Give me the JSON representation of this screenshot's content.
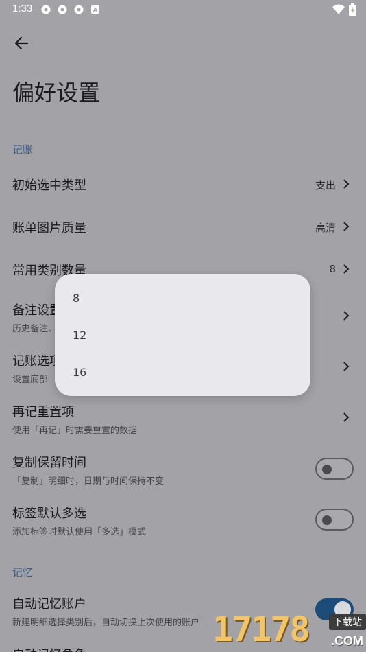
{
  "status_bar": {
    "time": "1:33",
    "icons": [
      "gear-icon",
      "gear-icon",
      "gear-icon",
      "app-a-icon"
    ],
    "right_icons": [
      "wifi-icon",
      "battery-icon"
    ]
  },
  "header": {
    "back_icon": "arrow-left-icon",
    "title": "偏好设置"
  },
  "sections": {
    "bookkeeping": {
      "label": "记账"
    },
    "memory": {
      "label": "记忆"
    }
  },
  "rows": {
    "initial_type": {
      "label": "初始选中类型",
      "value": "支出"
    },
    "image_quality": {
      "label": "账单图片质量",
      "value": "高清"
    },
    "category_count": {
      "label": "常用类别数量",
      "value": "8"
    },
    "note_settings": {
      "label": "备注设置",
      "sub": "历史备注、"
    },
    "bookkeeping_options": {
      "label": "记账选项",
      "sub": "设置底部"
    },
    "rerecord_reset": {
      "label": "再记重置项",
      "sub": "使用「再记」时需要重置的数据"
    },
    "copy_keep_time": {
      "label": "复制保留时间",
      "sub": "「复制」明细时，日期与时间保持不变",
      "enabled": false
    },
    "tag_multi_select": {
      "label": "标签默认多选",
      "sub": "添加标签时默认使用「多选」模式",
      "enabled": false
    },
    "auto_remember_account": {
      "label": "自动记忆账户",
      "sub": "新建明细选择类别后，自动切换上次使用的账户",
      "enabled": true
    },
    "auto_remember_role": {
      "label": "自动记忆角色"
    }
  },
  "popup": {
    "options": [
      "8",
      "12",
      "16"
    ]
  },
  "watermark": {
    "number": "17178",
    "badge": "下载站",
    "domain": ".COM"
  },
  "colors": {
    "background": "#a3a2a6",
    "accent": "#1e4c7a",
    "section_label": "#3b5d8a",
    "popup": "#e8e8ed"
  }
}
